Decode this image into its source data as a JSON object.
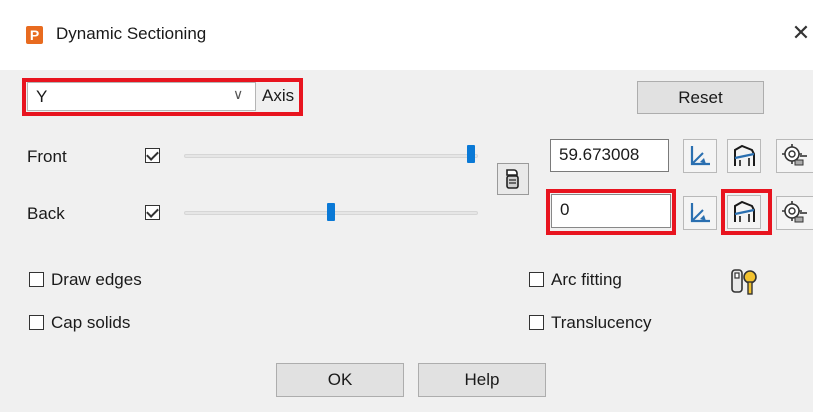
{
  "window": {
    "title": "Dynamic Sectioning",
    "app_icon": "P",
    "close": "✕"
  },
  "axis": {
    "value": "Y",
    "label": "Axis"
  },
  "buttons": {
    "reset": "Reset",
    "ok": "OK",
    "help": "Help"
  },
  "front": {
    "label": "Front",
    "checked": true,
    "value": "59.673008",
    "slider_fraction": 0.99
  },
  "back": {
    "label": "Back",
    "checked": true,
    "value": "0",
    "slider_fraction": 0.5
  },
  "options": {
    "draw_edges": "Draw edges",
    "cap_solids": "Cap solids",
    "arc_fitting": "Arc fitting",
    "translucency": "Translucency"
  },
  "colors": {
    "highlight": "#e8141f",
    "accent": "#0a79d6",
    "icon_blue": "#2a6fb0"
  }
}
